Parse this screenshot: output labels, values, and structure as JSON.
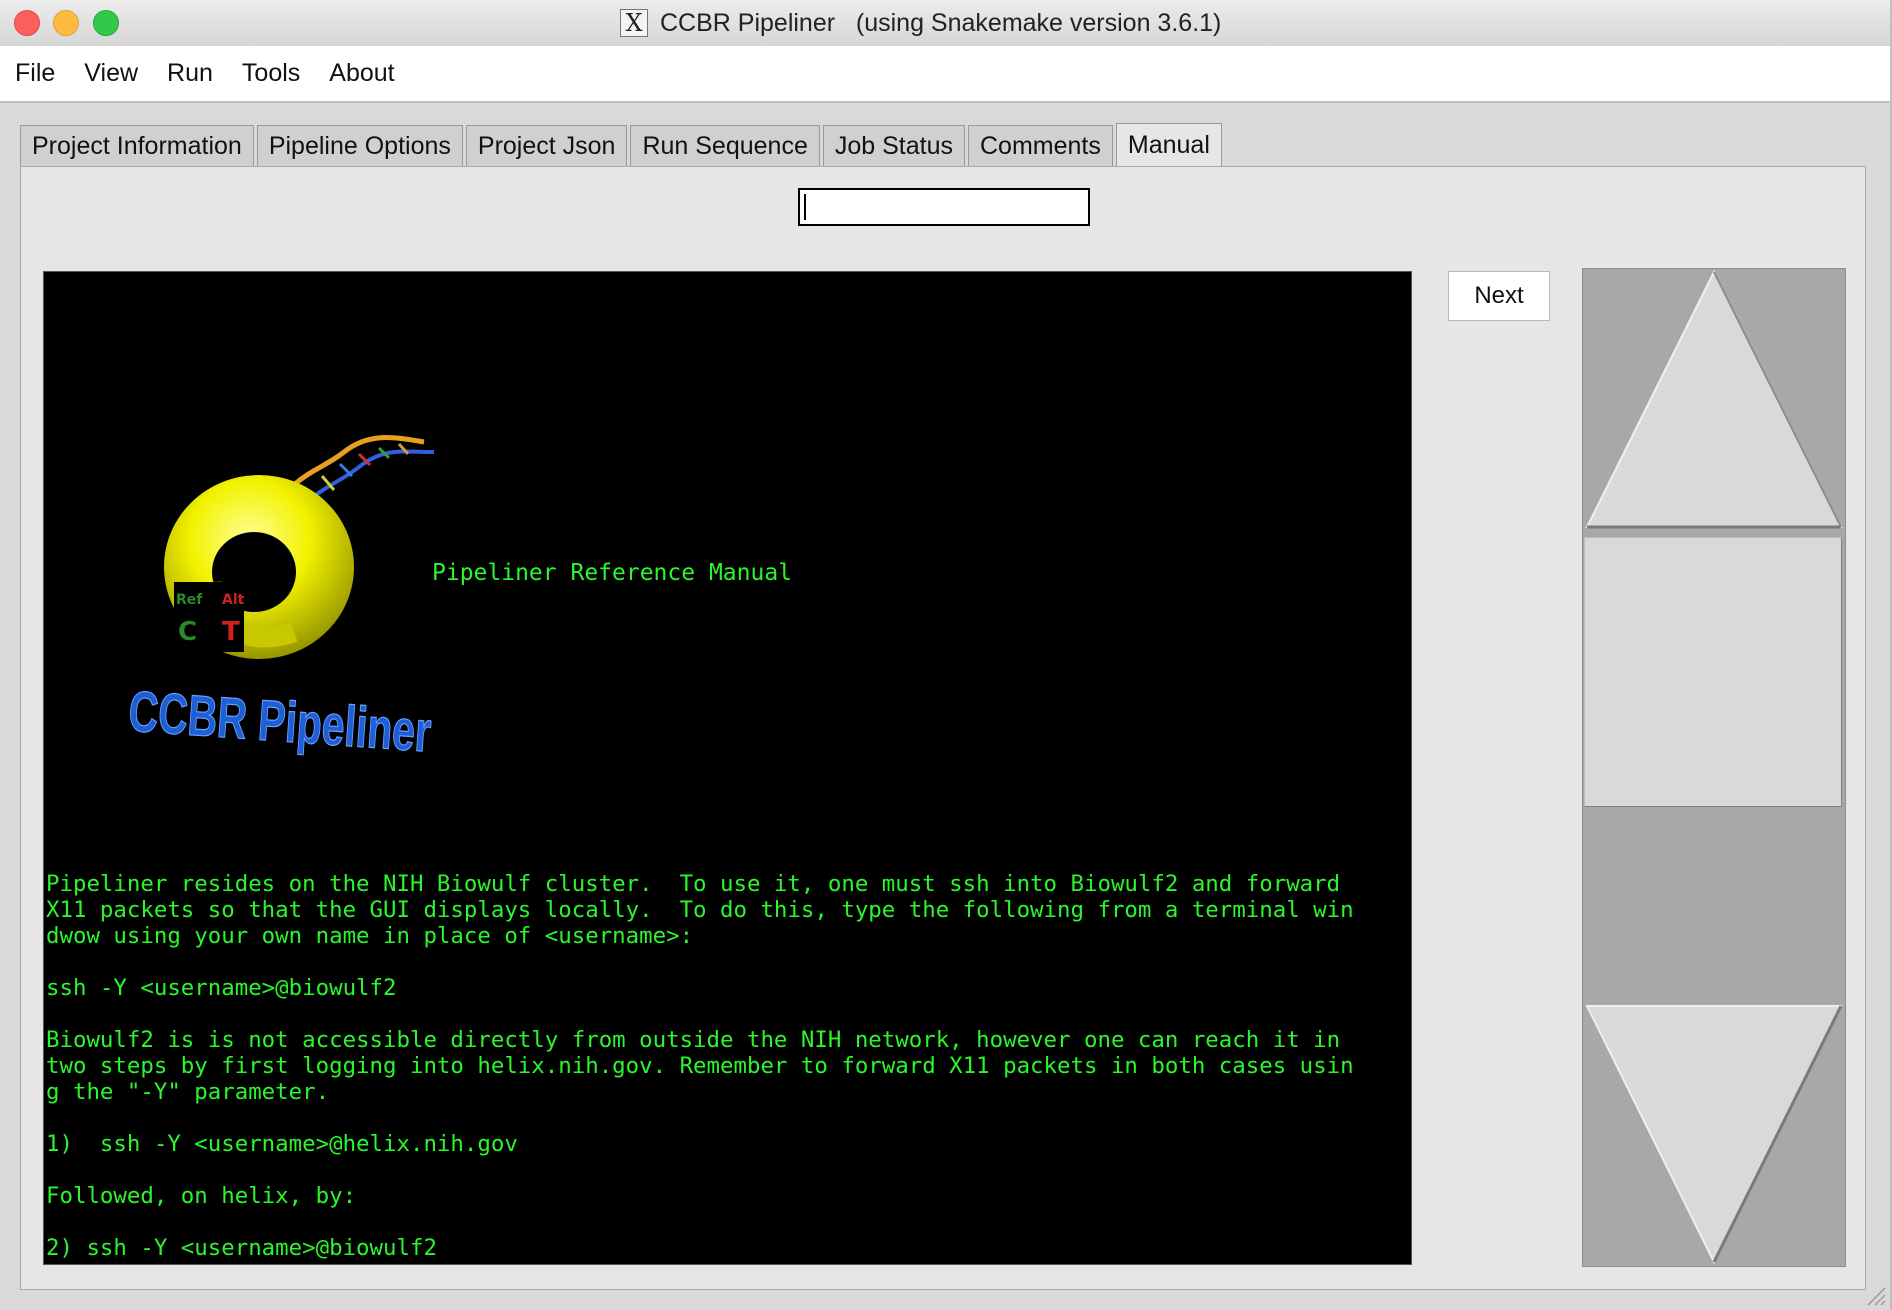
{
  "window": {
    "title": "CCBR Pipeliner   (using Snakemake version 3.6.1)",
    "x11_glyph": "X"
  },
  "menu": [
    "File",
    "View",
    "Run",
    "Tools",
    "About"
  ],
  "tabs": [
    {
      "label": "Project Information",
      "active": false
    },
    {
      "label": "Pipeline Options",
      "active": false
    },
    {
      "label": "Project Json",
      "active": false
    },
    {
      "label": "Run Sequence",
      "active": false
    },
    {
      "label": "Job Status",
      "active": false
    },
    {
      "label": "Comments",
      "active": false
    },
    {
      "label": "Manual",
      "active": true
    }
  ],
  "search": {
    "value": "",
    "placeholder": ""
  },
  "next_button": "Next",
  "manual": {
    "logo": {
      "ref": "Ref",
      "alt": "Alt",
      "ref_base": "C",
      "alt_base": "T",
      "wordmark": "CCBR Pipeliner"
    },
    "heading": "Pipeliner Reference Manual",
    "lines": [
      "Pipeliner resides on the NIH Biowulf cluster.  To use it, one must ssh into Biowulf2 and forward",
      "X11 packets so that the GUI displays locally.  To do this, type the following from a terminal win",
      "dwow using your own name in place of <username>:",
      "",
      "ssh -Y <username>@biowulf2",
      "",
      "Biowulf2 is is not accessible directly from outside the NIH network, however one can reach it in",
      "two steps by first logging into helix.nih.gov. Remember to forward X11 packets in both cases usin",
      "g the \"-Y\" parameter.",
      "",
      "1)  ssh -Y <username>@helix.nih.gov",
      "",
      "Followed, on helix, by:",
      "",
      "2) ssh -Y <username>@biowulf2"
    ]
  },
  "colors": {
    "terminal_bg": "#000000",
    "terminal_text": "#2cf52c",
    "logo_torus": "#f2f200",
    "logo_wordmark": "#1f5fd6"
  },
  "icons": {
    "close": "window-close-icon",
    "minimize": "window-minimize-icon",
    "maximize": "window-maximize-icon",
    "scroll_up": "triangle-up-icon",
    "scroll_down": "triangle-down-icon"
  }
}
